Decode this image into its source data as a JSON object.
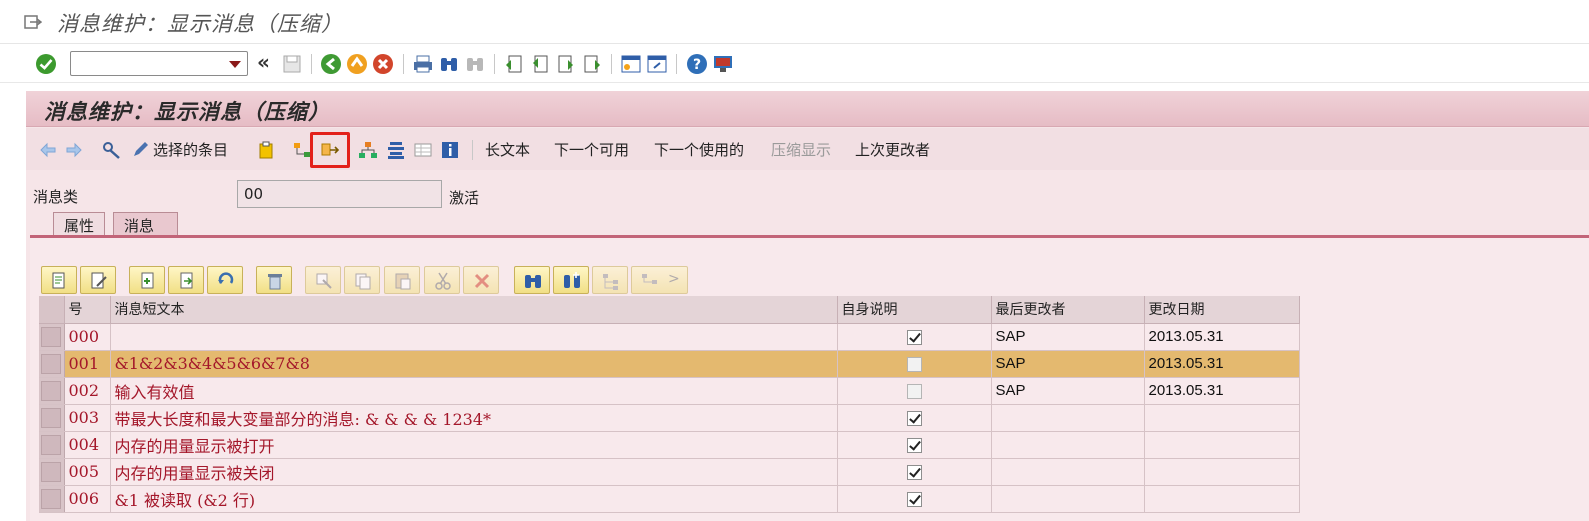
{
  "window": {
    "title": "消息维护：显示消息（压缩）"
  },
  "app": {
    "header": "消息维护：显示消息（压缩）",
    "toolbar": {
      "selected_items": "选择的条目",
      "long_text": "长文本",
      "next_available": "下一个可用",
      "next_used": "下一个使用的",
      "compress_display": "压缩显示",
      "last_changer": "上次更改者"
    },
    "message_class_label": "消息类",
    "message_class_value": "00",
    "status": "激活",
    "tabs": [
      "属性",
      "消息"
    ],
    "columns": [
      "号",
      "消息短文本",
      "自身说明",
      "最后更改者",
      "更改日期"
    ],
    "rows": [
      {
        "num": "000",
        "text": "",
        "self_explanatory": true,
        "changed_by": "SAP",
        "date": "2013.05.31"
      },
      {
        "num": "001",
        "text": "&1&2&3&4&5&6&7&8",
        "self_explanatory": false,
        "changed_by": "SAP",
        "date": "2013.05.31"
      },
      {
        "num": "002",
        "text": "输入有效值",
        "self_explanatory": false,
        "changed_by": "SAP",
        "date": "2013.05.31"
      },
      {
        "num": "003",
        "text": "带最大长度和最大变量部分的消息: & & & & 1234*",
        "self_explanatory": true,
        "changed_by": "",
        "date": ""
      },
      {
        "num": "004",
        "text": "内存的用量显示被打开",
        "self_explanatory": true,
        "changed_by": "",
        "date": ""
      },
      {
        "num": "005",
        "text": "内存的用量显示被关闭",
        "self_explanatory": true,
        "changed_by": "",
        "date": ""
      },
      {
        "num": "006",
        "text": "&1 被读取 (&2 行)",
        "self_explanatory": true,
        "changed_by": "",
        "date": ""
      }
    ]
  },
  "colors": {
    "highlight_row": "#e4b96f",
    "red_text": "#a4172a",
    "highlight_box": "#e3211b"
  }
}
